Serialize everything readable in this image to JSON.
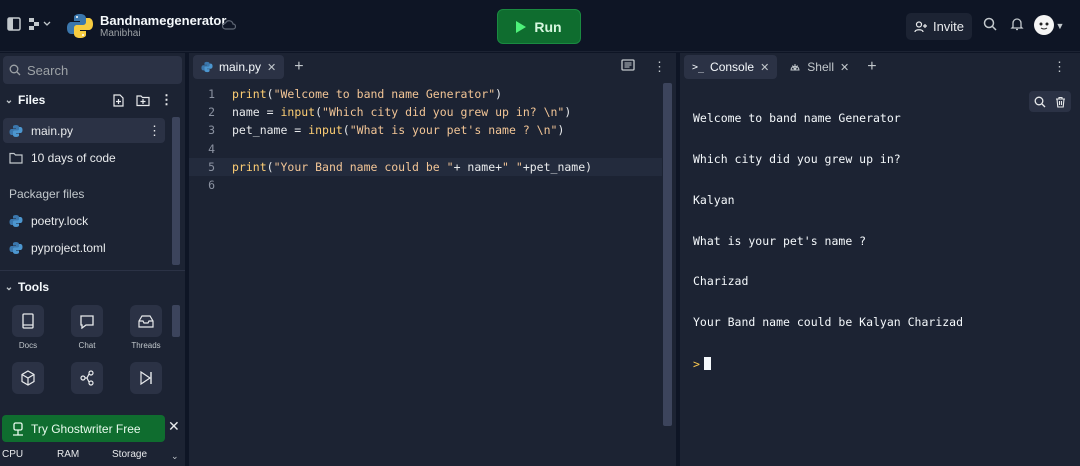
{
  "topbar": {
    "title": "Bandnamegenerator",
    "owner": "Manibhai",
    "run_label": "Run",
    "invite_label": "Invite"
  },
  "sidebar": {
    "search_placeholder": "Search",
    "files_label": "Files",
    "files": [
      {
        "name": "main.py",
        "type": "python"
      },
      {
        "name": "10 days of code",
        "type": "folder"
      }
    ],
    "packager_label": "Packager files",
    "packager_files": [
      {
        "name": "poetry.lock"
      },
      {
        "name": "pyproject.toml"
      }
    ],
    "tools_label": "Tools",
    "tools": [
      {
        "label": "Docs",
        "icon": "book-icon"
      },
      {
        "label": "Chat",
        "icon": "chat-icon"
      },
      {
        "label": "Threads",
        "icon": "inbox-icon"
      },
      {
        "label": "",
        "icon": "cube-icon"
      },
      {
        "label": "",
        "icon": "git-branch-icon"
      },
      {
        "label": "",
        "icon": "play-step-icon"
      }
    ],
    "ghostwriter_label": "Try Ghostwriter Free",
    "resources": [
      "CPU",
      "RAM",
      "Storage"
    ]
  },
  "editor": {
    "tab_label": "main.py",
    "lines": [
      {
        "n": "1",
        "code": "print(\"Welcome to band name Generator\")"
      },
      {
        "n": "2",
        "code": "name = input(\"Which city did you grew up in? \\n\")"
      },
      {
        "n": "3",
        "code": "pet_name = input(\"What is your pet's name ? \\n\")"
      },
      {
        "n": "4",
        "code": ""
      },
      {
        "n": "5",
        "code": "print(\"Your Band name could be \"+ name+\" \"+pet_name)"
      },
      {
        "n": "6",
        "code": ""
      }
    ],
    "active_line": 5
  },
  "console": {
    "tabs": [
      {
        "label": "Console",
        "icon": "terminal-icon",
        "active": true
      },
      {
        "label": "Shell",
        "icon": "shell-icon",
        "active": false
      }
    ],
    "output": [
      "Welcome to band name Generator",
      "Which city did you grew up in?",
      "Kalyan",
      "What is your pet's name ?",
      "Charizad",
      "Your Band name could be Kalyan Charizad"
    ],
    "prompt_symbol": ">"
  }
}
